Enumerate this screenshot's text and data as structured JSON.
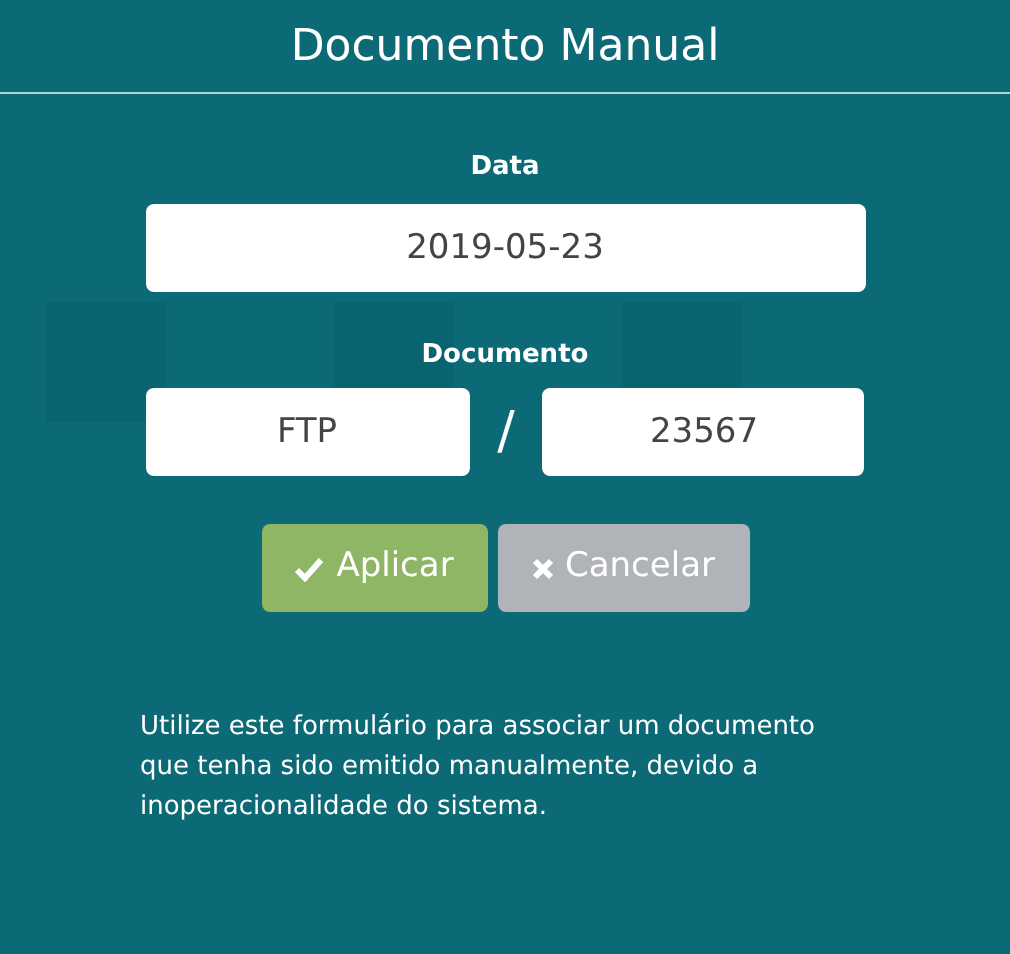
{
  "dialog": {
    "title": "Documento Manual",
    "date": {
      "label": "Data",
      "value": "2019-05-23"
    },
    "document": {
      "label": "Documento",
      "series": "FTP",
      "separator": "/",
      "number": "23567"
    },
    "buttons": [
      {
        "kind": "apply",
        "label": "Aplicar"
      },
      {
        "kind": "cancel",
        "label": "Cancelar"
      }
    ],
    "note": "Utilize este formulário para associar um documento que tenha sido emitido manualmente, devido a inoperacionalidade do sistema."
  }
}
